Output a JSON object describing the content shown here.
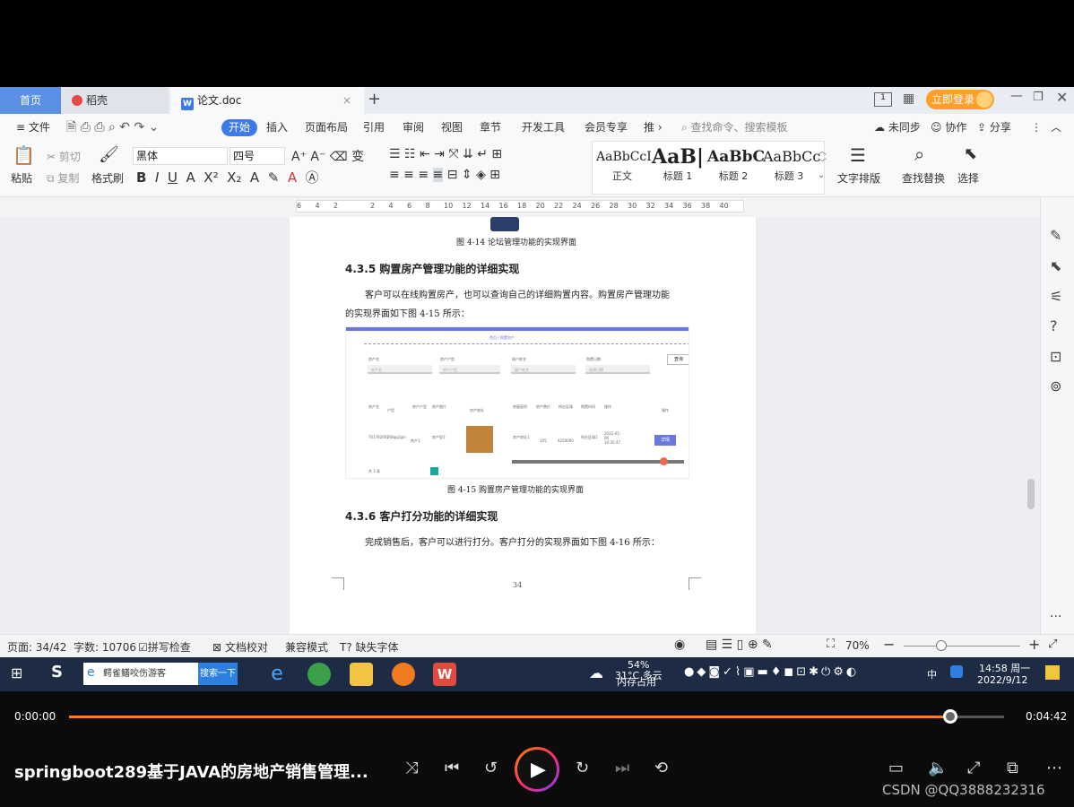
{
  "tabs": {
    "home": "首页",
    "daoke": "稻壳",
    "doc": "论文.doc",
    "login": "立即登录"
  },
  "menu": {
    "file": "文件",
    "start": "开始",
    "insert": "插入",
    "layout": "页面布局",
    "ref": "引用",
    "review": "审阅",
    "view": "视图",
    "chapter": "章节",
    "dev": "开发工具",
    "member": "会员专享",
    "more": "推",
    "search_placeholder": "查找命令、搜索模板",
    "sync": "未同步",
    "collab": "协作",
    "share": "分享"
  },
  "ribbon": {
    "paste": "粘贴",
    "cut": "剪切",
    "copy": "复制",
    "format_painter": "格式刷",
    "font": "黑体",
    "size": "四号",
    "styles": [
      {
        "sample": "AaBbCcI",
        "name": "正文"
      },
      {
        "sample": "AaB|",
        "name": "标题 1"
      },
      {
        "sample": "AaBbC",
        "name": "标题 2"
      },
      {
        "sample": "AaBbCc",
        "name": "标题 3"
      }
    ],
    "text_layout": "文字排版",
    "find_replace": "查找替换",
    "select": "选择"
  },
  "ruler": [
    "6",
    "4",
    "2",
    "",
    "2",
    "4",
    "6",
    "8",
    "10",
    "12",
    "14",
    "16",
    "18",
    "20",
    "22",
    "24",
    "26",
    "28",
    "30",
    "32",
    "34",
    "36",
    "38",
    "40"
  ],
  "doc": {
    "caption_414": "图 4-14 论坛管理功能的实现界面",
    "h435": "4.3.5 购置房产管理功能的详细实现",
    "p435_line1": "客户可以在线购置房产，也可以查询自己的详细购置内容。购置房产管理功能",
    "p435_line2": "的实现界面如下图 4-15 所示：",
    "caption_415": "图 4-15 购置房产管理功能的实现界面",
    "h436": "4.3.6 客户打分功能的详细实现",
    "p436": "完成销售后，客户可以进行打分。客户打分的实现界面如下图 4-16 所示：",
    "page_number": "34"
  },
  "embedded": {
    "breadcrumb": "首页 / 购置房产",
    "query": "查询",
    "filters": [
      "房产名",
      "房产户型",
      "账户姓名",
      "购置日期"
    ],
    "placeholders": [
      "房产名",
      "房产户型",
      "客户姓名",
      "选择日期"
    ],
    "columns": [
      "房产名",
      "户型",
      "房产户型",
      "房产图片",
      "房产地址",
      "房屋面积",
      "房产售价",
      "所在区域",
      "购置时间",
      "操作"
    ],
    "row": [
      "701782002",
      "巧Bqq1gm",
      "房产1",
      "房产型3",
      "",
      "房产地址1",
      "105",
      "4250000",
      "所在区域1",
      "2022-01-06 10:35:47",
      "详情"
    ],
    "pager": "共 1 条"
  },
  "status": {
    "page": "页面: 34/42",
    "words": "字数: 10706",
    "spell": "拼写检查",
    "proof": "文档校对",
    "compat": "兼容模式",
    "missing_font": "缺失字体",
    "zoom": "70%"
  },
  "taskbar": {
    "search_text": "鳄雀鳝咬伤游客",
    "search_btn": "搜索一下",
    "weather": "31°C 多云",
    "memory": "54%",
    "memory_label": "内存占用",
    "ime": "中",
    "time": "14:58 周一",
    "date": "2022/9/12"
  },
  "player": {
    "current": "0:00:00",
    "total": "0:04:42",
    "progress_fraction": 0.942,
    "title": "springboot289基于JAVA的房地产销售管理...",
    "watermark": "CSDN @QQ3888232316"
  },
  "colors": {
    "accent": "#3d7ae8",
    "progress": "#ff7a1a",
    "login": "#ff9f2a"
  }
}
